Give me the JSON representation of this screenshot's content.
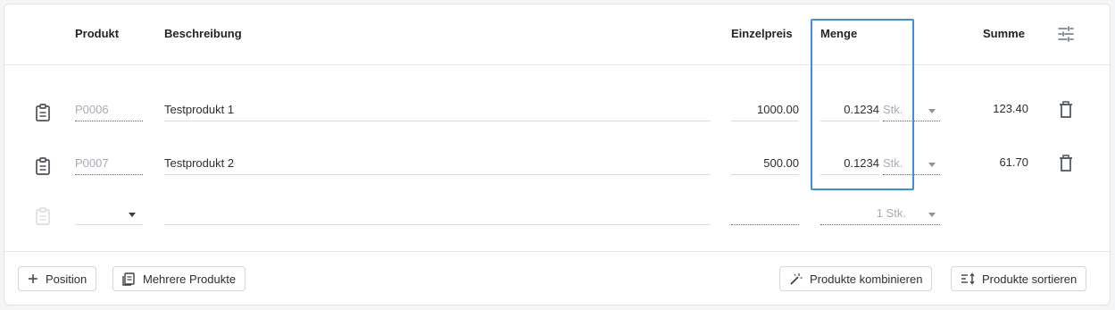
{
  "columns": {
    "product": "Produkt",
    "description": "Beschreibung",
    "unit_price": "Einzelpreis",
    "quantity": "Menge",
    "total": "Summe"
  },
  "rows": [
    {
      "product_code": "P0006",
      "description": "Testprodukt 1",
      "unit_price": "1000.00",
      "quantity": "0.1234",
      "unit": "Stk.",
      "total": "123.40"
    },
    {
      "product_code": "P0007",
      "description": "Testprodukt 2",
      "unit_price": "500.00",
      "quantity": "0.1234",
      "unit": "Stk.",
      "total": "61.70"
    }
  ],
  "new_row": {
    "quantity_unit": "1 Stk."
  },
  "buttons": {
    "add_position": "Position",
    "multiple_products": "Mehrere Produkte",
    "combine_products": "Produkte kombinieren",
    "sort_products": "Produkte sortieren"
  },
  "colors": {
    "highlight": "#3b8ee0",
    "border": "#d3d7dc"
  }
}
